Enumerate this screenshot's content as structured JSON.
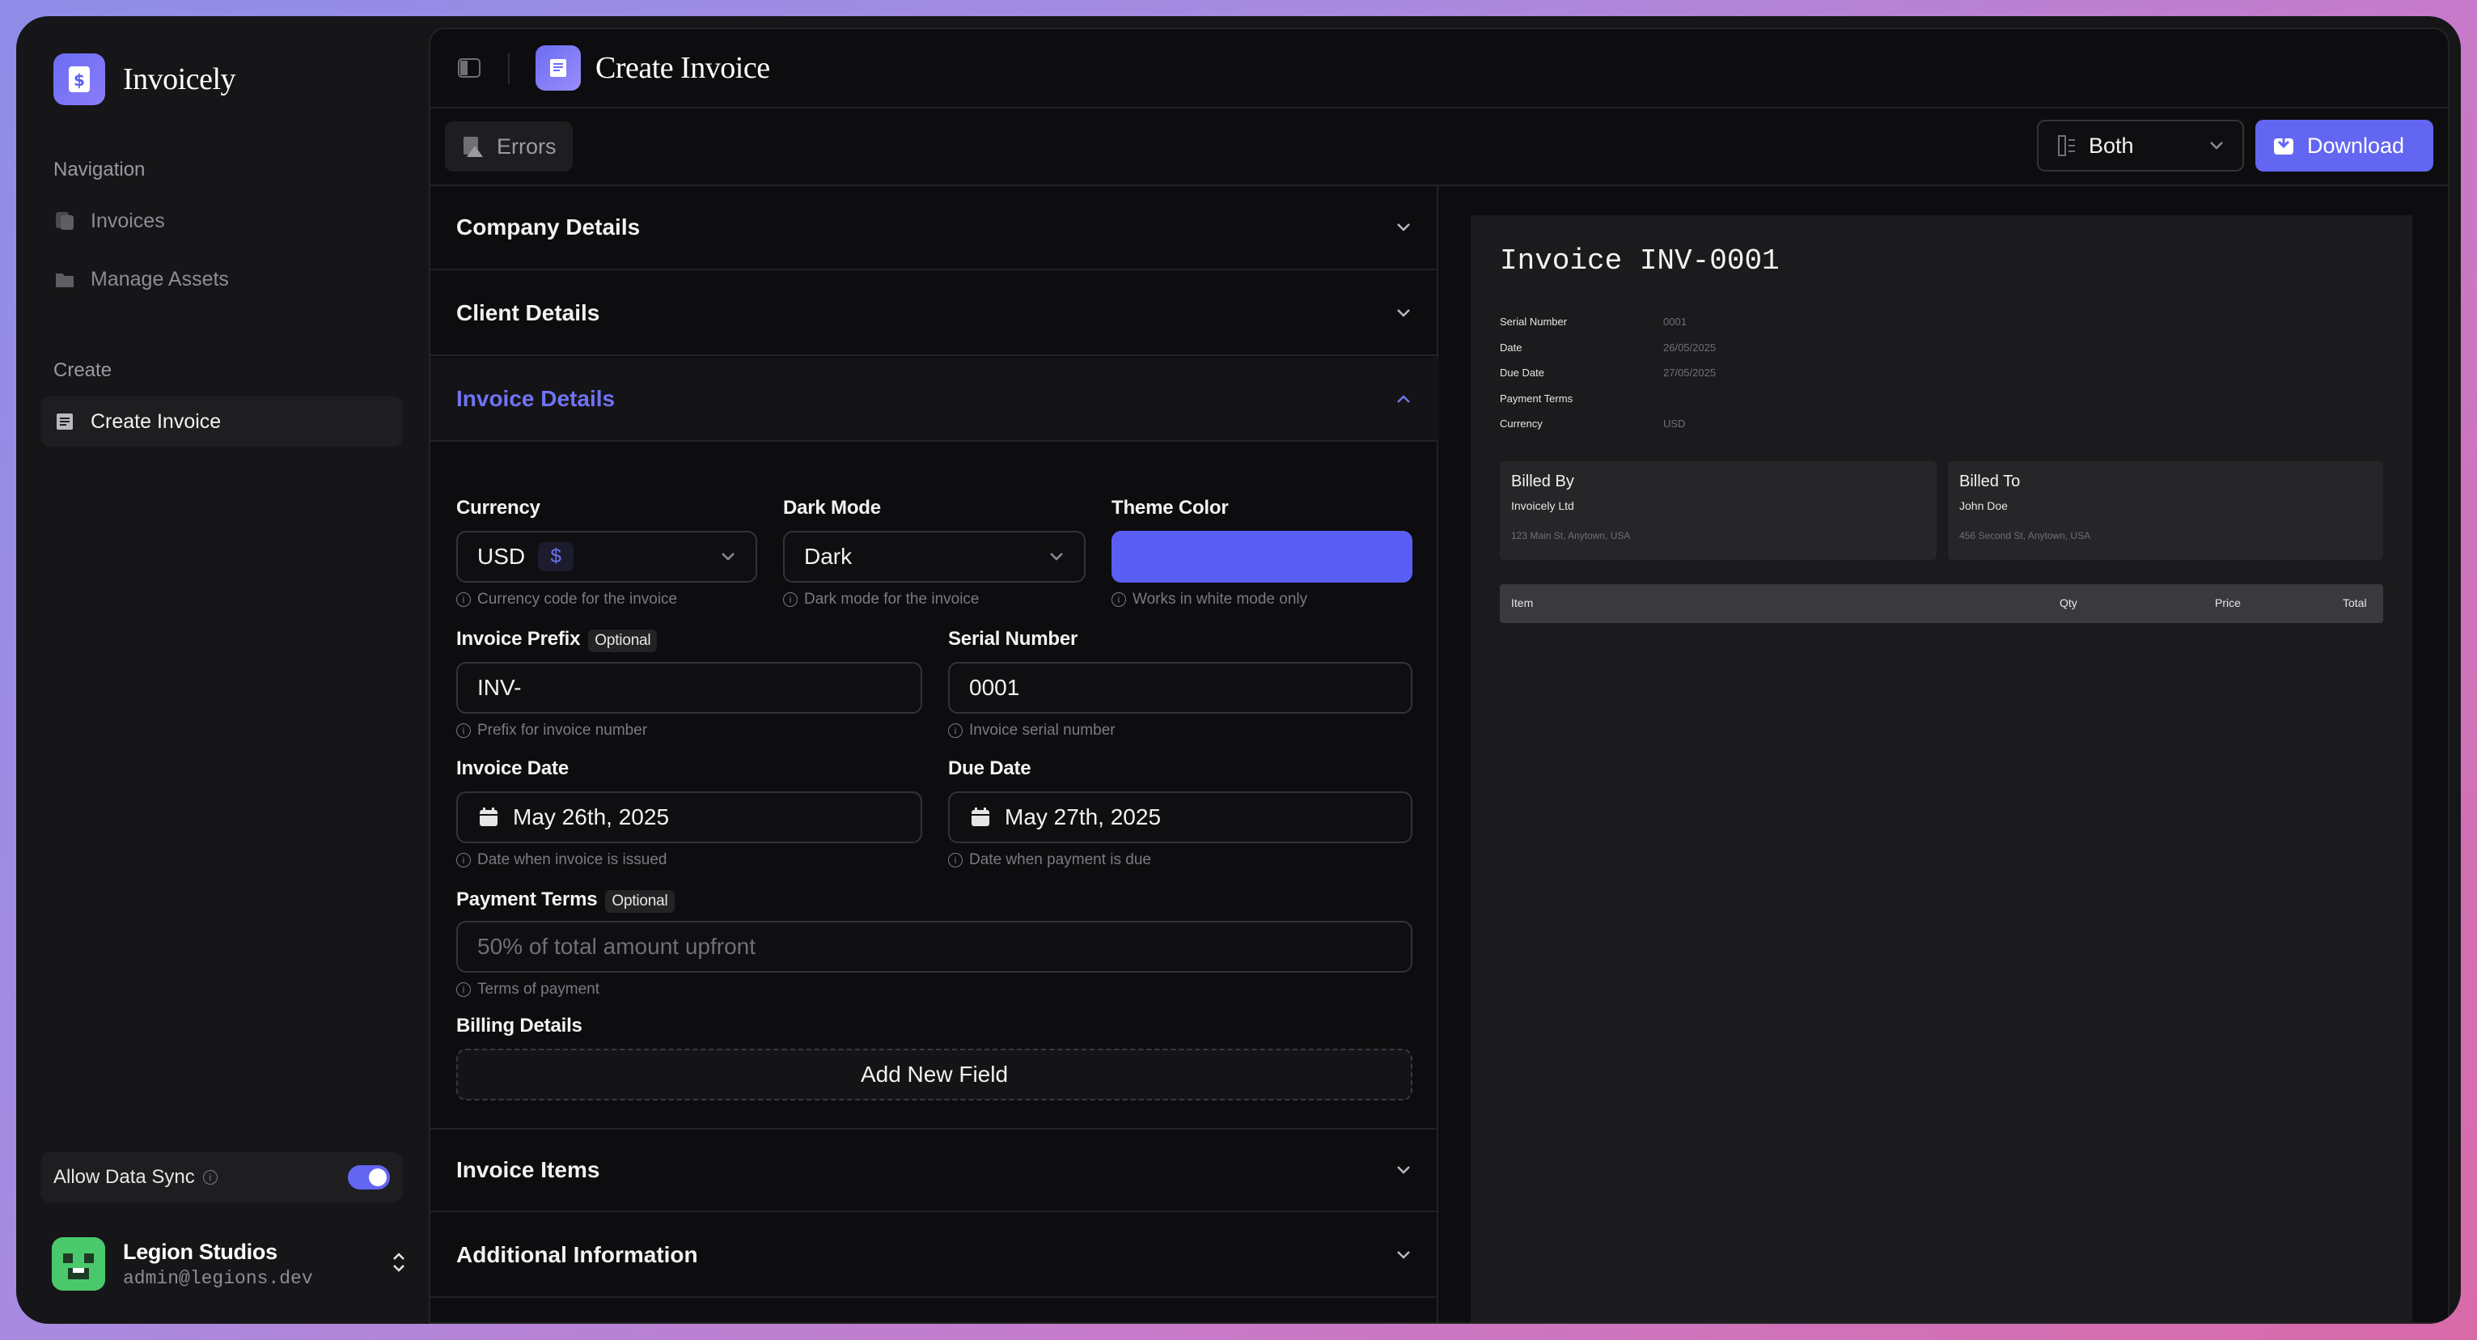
{
  "brand": {
    "name": "Invoicely"
  },
  "sidebar": {
    "nav_label": "Navigation",
    "nav_items": [
      {
        "label": "Invoices",
        "icon": "invoices-icon"
      },
      {
        "label": "Manage Assets",
        "icon": "folder-icon"
      }
    ],
    "create_label": "Create",
    "create_items": [
      {
        "label": "Create Invoice",
        "icon": "receipt-icon",
        "active": true
      }
    ],
    "sync": {
      "label": "Allow Data Sync",
      "enabled": true
    },
    "user": {
      "name": "Legion Studios",
      "email": "admin@legions.dev"
    }
  },
  "header": {
    "title": "Create Invoice"
  },
  "toolbar": {
    "errors_label": "Errors",
    "view_select": "Both",
    "download_label": "Download"
  },
  "sections": {
    "company": "Company Details",
    "client": "Client Details",
    "invoice": "Invoice Details",
    "items": "Invoice Items",
    "additional": "Additional Information"
  },
  "form": {
    "currency": {
      "label": "Currency",
      "value": "USD",
      "symbol": "$",
      "hint": "Currency code for the invoice"
    },
    "dark_mode": {
      "label": "Dark Mode",
      "value": "Dark",
      "hint": "Dark mode for the invoice"
    },
    "theme_color": {
      "label": "Theme Color",
      "value": "#5b5ef5",
      "hint": "Works in white mode only"
    },
    "prefix": {
      "label": "Invoice Prefix",
      "badge": "Optional",
      "value": "INV-",
      "hint": "Prefix for invoice number"
    },
    "serial": {
      "label": "Serial Number",
      "value": "0001",
      "hint": "Invoice serial number"
    },
    "invoice_date": {
      "label": "Invoice Date",
      "value": "May 26th, 2025",
      "hint": "Date when invoice is issued"
    },
    "due_date": {
      "label": "Due Date",
      "value": "May 27th, 2025",
      "hint": "Date when payment is due"
    },
    "payment_terms": {
      "label": "Payment Terms",
      "badge": "Optional",
      "placeholder": "50% of total amount upfront",
      "hint": "Terms of payment"
    },
    "billing": {
      "label": "Billing Details",
      "add_label": "Add New Field"
    }
  },
  "preview": {
    "title": "Invoice INV-0001",
    "rows": [
      {
        "label": "Serial Number",
        "value": "0001"
      },
      {
        "label": "Date",
        "value": "26/05/2025"
      },
      {
        "label": "Due Date",
        "value": "27/05/2025"
      },
      {
        "label": "Payment Terms",
        "value": ""
      },
      {
        "label": "Currency",
        "value": "USD"
      }
    ],
    "billed_by": {
      "heading": "Billed By",
      "name": "Invoicely Ltd",
      "address": "123 Main St, Anytown, USA"
    },
    "billed_to": {
      "heading": "Billed To",
      "name": "John Doe",
      "address": "456 Second St, Anytown, USA"
    },
    "table_headers": {
      "item": "Item",
      "qty": "Qty",
      "price": "Price",
      "total": "Total"
    }
  },
  "colors": {
    "accent": "#6366f1",
    "background": "#0d0d0f"
  }
}
